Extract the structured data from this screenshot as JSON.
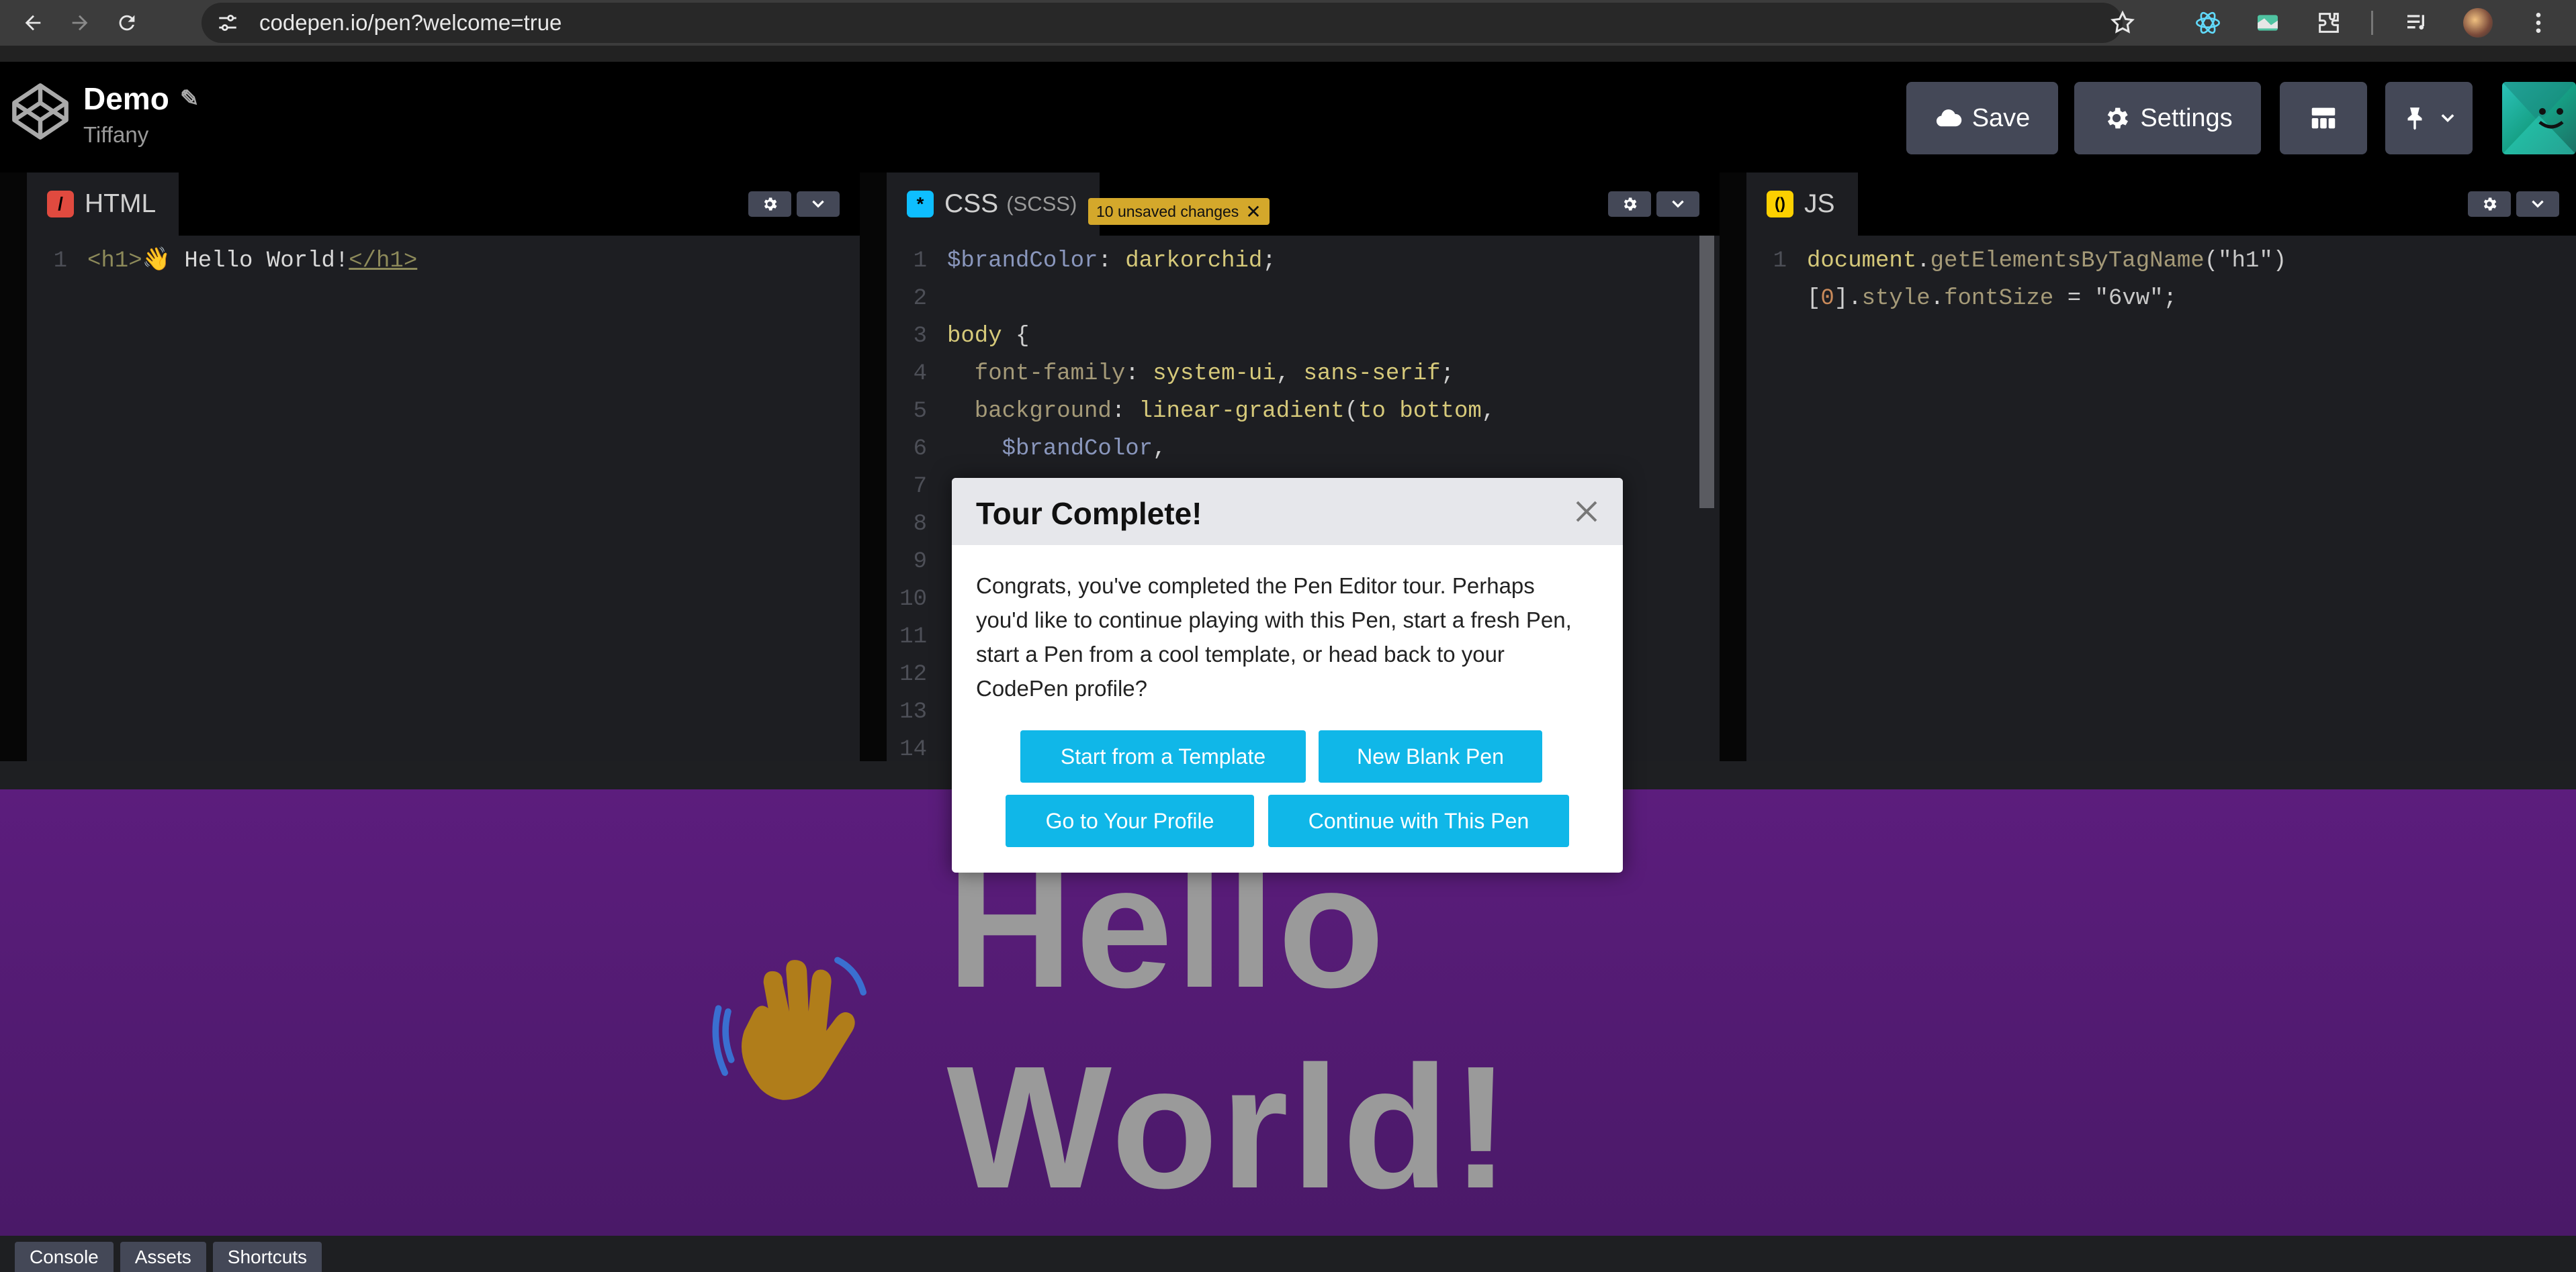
{
  "browser": {
    "url": "codepen.io/pen?welcome=true",
    "colors": {
      "bar": "#3c3c3c",
      "omnibox": "#282828"
    }
  },
  "header": {
    "pen_title": "Demo",
    "user": "Tiffany",
    "save_label": "Save",
    "settings_label": "Settings"
  },
  "editors": {
    "html": {
      "label": "HTML",
      "code": [
        {
          "n": "1",
          "html": "<span style=\"color:#8d8a5a\">&lt;h1&gt;</span>👋 <span style=\"color:#d9d9d9\">Hello World!</span><span style=\"color:#8d8a5a;text-decoration:underline\">&lt;/h1&gt;</span>"
        }
      ]
    },
    "css": {
      "label": "CSS",
      "sublabel": "(SCSS)",
      "unsaved": "10 unsaved changes",
      "code": [
        {
          "n": "1",
          "html": "<span style=\"color:#8a97bd\">$brandColor</span><span style=\"color:#cfcfcf\">: </span><span style=\"color:#d6c97a\">darkorchid</span><span style=\"color:#cfcfcf\">;</span>"
        },
        {
          "n": "2",
          "html": ""
        },
        {
          "n": "3",
          "html": "<span style=\"color:#d6c97a\">body</span><span style=\"color:#cfcfcf\"> {</span>"
        },
        {
          "n": "4",
          "html": "<span style=\"color:#a59a78\">  font-family</span><span style=\"color:#cfcfcf\">: </span><span style=\"color:#d6c97a\">system-ui</span><span style=\"color:#cfcfcf\">, </span><span style=\"color:#d6c97a\">sans-serif</span><span style=\"color:#cfcfcf\">;</span>"
        },
        {
          "n": "5",
          "html": "<span style=\"color:#a59a78\">  background</span><span style=\"color:#cfcfcf\">: </span><span style=\"color:#d6c97a\">linear-gradient</span><span style=\"color:#cfcfcf\">(</span><span style=\"color:#d6c97a\">to bottom</span><span style=\"color:#cfcfcf\">,</span>"
        },
        {
          "n": "6",
          "html": "<span style=\"color:#8a97bd\">    $brandColor</span><span style=\"color:#cfcfcf\">,</span>"
        },
        {
          "n": "7",
          "html": ""
        },
        {
          "n": "8",
          "html": ""
        },
        {
          "n": "9",
          "html": ""
        },
        {
          "n": "10",
          "html": ""
        },
        {
          "n": "11",
          "html": ""
        },
        {
          "n": "12",
          "html": ""
        },
        {
          "n": "13",
          "html": ""
        },
        {
          "n": "14",
          "html": ""
        }
      ]
    },
    "js": {
      "label": "JS",
      "code": [
        {
          "n": "1",
          "html": "<span style=\"color:#d6c97a\">document</span><span style=\"color:#cfcfcf\">.</span><span style=\"color:#a59a78\">getElementsByTagName</span><span style=\"color:#cfcfcf\">(</span><span style=\"color:#c9c9c9\">\"h1\"</span><span style=\"color:#cfcfcf\">)</span>"
        },
        {
          "n": "",
          "html": "<span style=\"color:#cfcfcf\">[</span><span style=\"color:#c98a5a\">0</span><span style=\"color:#cfcfcf\">].</span><span style=\"color:#a59a78\">style</span><span style=\"color:#cfcfcf\">.</span><span style=\"color:#a59a78\">fontSize</span><span style=\"color:#cfcfcf\"> = </span><span style=\"color:#c9c9c9\">\"6vw\"</span><span style=\"color:#cfcfcf\">;</span>"
        }
      ]
    }
  },
  "preview": {
    "emoji": "👋",
    "heading": "Hello World!"
  },
  "modal": {
    "title": "Tour Complete!",
    "body": "Congrats, you've completed the Pen Editor tour. Perhaps you'd like to continue playing with this Pen, start a fresh Pen, start a Pen from a cool template, or head back to your CodePen profile?",
    "buttons": {
      "template": "Start from a Template",
      "blank": "New Blank Pen",
      "profile": "Go to Your Profile",
      "continue": "Continue with This Pen"
    },
    "accent": "#10b7e8"
  },
  "bottom": {
    "console": "Console",
    "assets": "Assets",
    "shortcuts": "Shortcuts"
  }
}
